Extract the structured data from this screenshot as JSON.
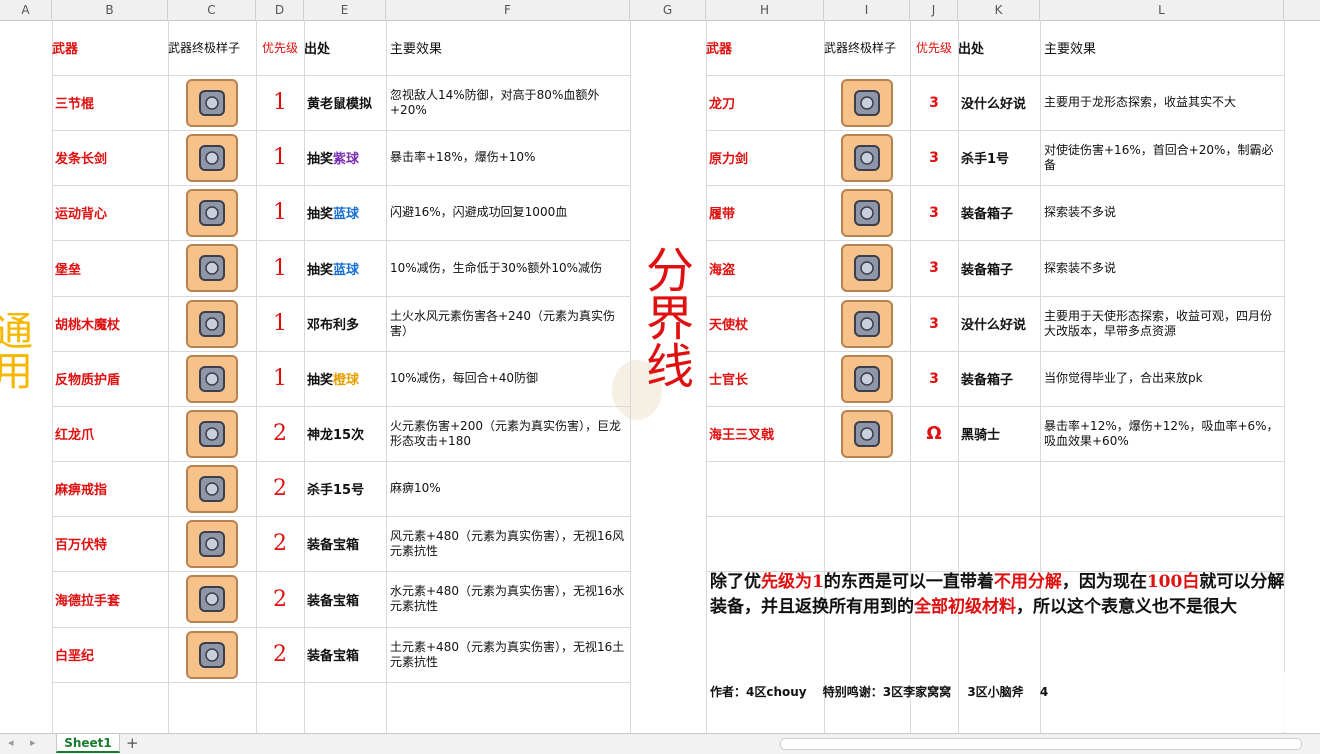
{
  "columns": [
    "A",
    "B",
    "C",
    "D",
    "E",
    "F",
    "G",
    "H",
    "I",
    "J",
    "K",
    "L"
  ],
  "headers_left": {
    "weapon": "武器",
    "sample": "武器终极样子",
    "priority": "优先级",
    "source": "出处",
    "effect": "主要效果"
  },
  "headers_right": {
    "weapon": "武器",
    "sample": "武器终极样子",
    "priority": "优先级",
    "source": "出处",
    "effect": "主要效果"
  },
  "left_label": "通用",
  "divider_label": "分界线",
  "left_rows": [
    {
      "name": "三节棍",
      "priority": "1",
      "source": "黄老鼠模拟",
      "source_hl": "",
      "effect": "忽视敌人14%防御，对高于80%血额外+20%",
      "icon": "nunchaku-icon"
    },
    {
      "name": "发条长剑",
      "priority": "1",
      "source": "抽奖",
      "source_hl": "紫球",
      "hl_color": "#7a2fb5",
      "effect": "暴击率+18%，爆伤+10%",
      "icon": "sword-icon"
    },
    {
      "name": "运动背心",
      "priority": "1",
      "source": "抽奖",
      "source_hl": "蓝球",
      "hl_color": "#1a6fd6",
      "effect": "闪避16%，闪避成功回复1000血",
      "icon": "vest-icon"
    },
    {
      "name": "堡垒",
      "priority": "1",
      "source": "抽奖",
      "source_hl": "蓝球",
      "hl_color": "#1a6fd6",
      "effect": "10%减伤，生命低于30%额外10%减伤",
      "icon": "fortress-icon"
    },
    {
      "name": "胡桃木魔杖",
      "priority": "1",
      "source": "邓布利多",
      "source_hl": "",
      "effect": "土火水风元素伤害各+240（元素为真实伤害）",
      "icon": "wand-icon"
    },
    {
      "name": "反物质护盾",
      "priority": "1",
      "source": "抽奖",
      "source_hl": "橙球",
      "hl_color": "#e8a000",
      "effect": "10%减伤，每回合+40防御",
      "icon": "shield-icon"
    },
    {
      "name": "红龙爪",
      "priority": "2",
      "source": "神龙15次",
      "source_hl": "",
      "effect": "火元素伤害+200（元素为真实伤害），巨龙形态攻击+180",
      "icon": "claw-icon"
    },
    {
      "name": "麻痹戒指",
      "priority": "2",
      "source": "杀手15号",
      "source_hl": "",
      "effect": "麻痹10%",
      "icon": "ring-icon"
    },
    {
      "name": "百万伏特",
      "priority": "2",
      "source": "装备宝箱",
      "source_hl": "",
      "effect": "风元素+480（元素为真实伤害），无视16风元素抗性",
      "icon": "hammer-icon"
    },
    {
      "name": "海德拉手套",
      "priority": "2",
      "source": "装备宝箱",
      "source_hl": "",
      "effect": "水元素+480（元素为真实伤害），无视16水元素抗性",
      "icon": "glove-icon"
    },
    {
      "name": "白垩纪",
      "priority": "2",
      "source": "装备宝箱",
      "source_hl": "",
      "effect": "土元素+480（元素为真实伤害），无视16土元素抗性",
      "icon": "fossil-icon"
    }
  ],
  "right_rows": [
    {
      "name": "龙刀",
      "priority": "3",
      "source": "没什么好说",
      "effect": "主要用于龙形态探索，收益其实不大",
      "icon": "dagger-icon"
    },
    {
      "name": "原力剑",
      "priority": "3",
      "source": "杀手1号",
      "effect": "对使徒伤害+16%，首回合+20%，制霸必备",
      "icon": "force-sword-icon"
    },
    {
      "name": "履带",
      "priority": "3",
      "source": "装备箱子",
      "effect": "探索装不多说",
      "icon": "track-icon"
    },
    {
      "name": "海盗",
      "priority": "3",
      "source": "装备箱子",
      "effect": "探索装不多说",
      "icon": "hook-icon"
    },
    {
      "name": "天使杖",
      "priority": "3",
      "source": "没什么好说",
      "effect": "主要用于天使形态探索，收益可观，四月份大改版本，早带多点资源",
      "icon": "angel-staff-icon"
    },
    {
      "name": "士官长",
      "priority": "3",
      "source": "装备箱子",
      "effect": "当你觉得毕业了，合出来放pk",
      "icon": "armor-icon"
    },
    {
      "name": "海王三叉戟",
      "priority": "Ω",
      "source": "黑骑士",
      "effect": "暴击率+12%，爆伤+12%，吸血率+6%，吸血效果+60%",
      "icon": "trident-icon"
    }
  ],
  "note": {
    "parts": [
      {
        "t": "除了优",
        "red": false
      },
      {
        "t": "先级为1",
        "red": true
      },
      {
        "t": "的东西是可以一直带着",
        "red": false
      },
      {
        "t": "不用分解",
        "red": true
      },
      {
        "t": "，因为现在",
        "red": false
      },
      {
        "t": "100白",
        "red": true
      },
      {
        "t": "就可以分解装备，并且返换所有用到的",
        "red": false
      },
      {
        "t": "全部初级材料",
        "red": true
      },
      {
        "t": "，所以这个表意义也不是很大",
        "red": false
      }
    ]
  },
  "author": "作者：4区chouy　 特别鸣谢：3区李家窝窝　 3区小脑斧　 4",
  "sheet_tab": "Sheet1",
  "add_sheet": "+",
  "colors": {
    "red": "#e01010",
    "label_yellow": "#f5b700",
    "sheet_green": "#1a7a2e"
  }
}
